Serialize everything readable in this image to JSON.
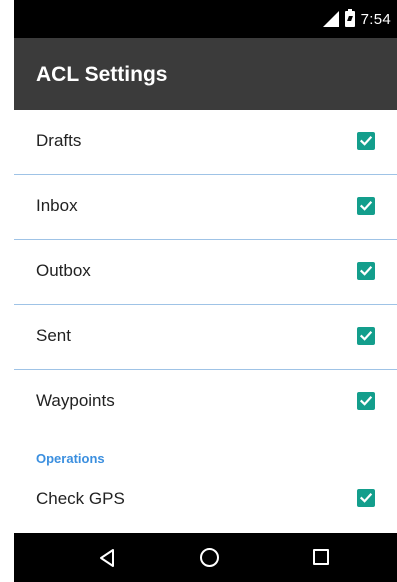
{
  "status_bar": {
    "time": "7:54",
    "icons": [
      "signal-icon",
      "battery-icon"
    ]
  },
  "app_bar": {
    "title": "ACL Settings"
  },
  "items": [
    {
      "label": "Drafts",
      "checked": true
    },
    {
      "label": "Inbox",
      "checked": true
    },
    {
      "label": "Outbox",
      "checked": true
    },
    {
      "label": "Sent",
      "checked": true
    },
    {
      "label": "Waypoints",
      "checked": true
    }
  ],
  "operations": {
    "header": "Operations",
    "items": [
      {
        "label": "Check GPS",
        "checked": true
      }
    ]
  },
  "nav_bar": {
    "icons": [
      "back-icon",
      "home-icon",
      "recent-apps-icon"
    ]
  },
  "colors": {
    "accent": "#139e8c",
    "app_bar": "#3b3b3b",
    "section_header": "#3b8fdf",
    "divider": "#9fc3e6"
  }
}
